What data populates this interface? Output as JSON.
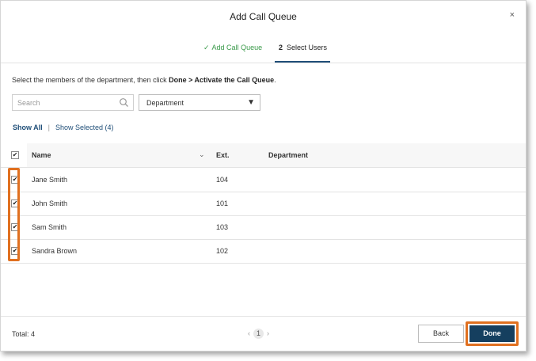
{
  "dialog": {
    "title": "Add Call Queue",
    "close_glyph": "×"
  },
  "steps": [
    {
      "label": "Add Call Queue",
      "status": "complete",
      "icon": "check-icon",
      "glyph": "✓"
    },
    {
      "number": "2",
      "label": "Select Users",
      "status": "active"
    }
  ],
  "instructions": {
    "prefix": "Select the members of the department, then click ",
    "bold1": "Done",
    "middle": " > ",
    "bold2": "Activate the Call Queue",
    "suffix": "."
  },
  "search": {
    "placeholder": "Search",
    "value": "",
    "icon": "search-icon"
  },
  "department_select": {
    "value": "Department",
    "arrow": "▼"
  },
  "filters": {
    "show_all": "Show All",
    "separator": "|",
    "show_selected": "Show Selected (4)"
  },
  "table": {
    "header_checked": true,
    "columns": [
      "Name",
      "Ext.",
      "Department"
    ],
    "sort_chevron": "⌄",
    "rows": [
      {
        "name": "Jane Smith",
        "ext": "104",
        "department": "",
        "checked": true
      },
      {
        "name": "John Smith",
        "ext": "101",
        "department": "",
        "checked": true
      },
      {
        "name": "Sam Smith",
        "ext": "103",
        "department": "",
        "checked": true
      },
      {
        "name": "Sandra Brown",
        "ext": "102",
        "department": "",
        "checked": true
      }
    ]
  },
  "footer": {
    "total": "Total: 4",
    "pager": {
      "prev": "‹",
      "page": "1",
      "next": "›"
    },
    "back_label": "Back",
    "done_label": "Done"
  },
  "colors": {
    "accent": "#1f4e78",
    "done_bg": "#153f5f",
    "highlight": "#e07020",
    "step_complete": "#3a9a4a"
  }
}
